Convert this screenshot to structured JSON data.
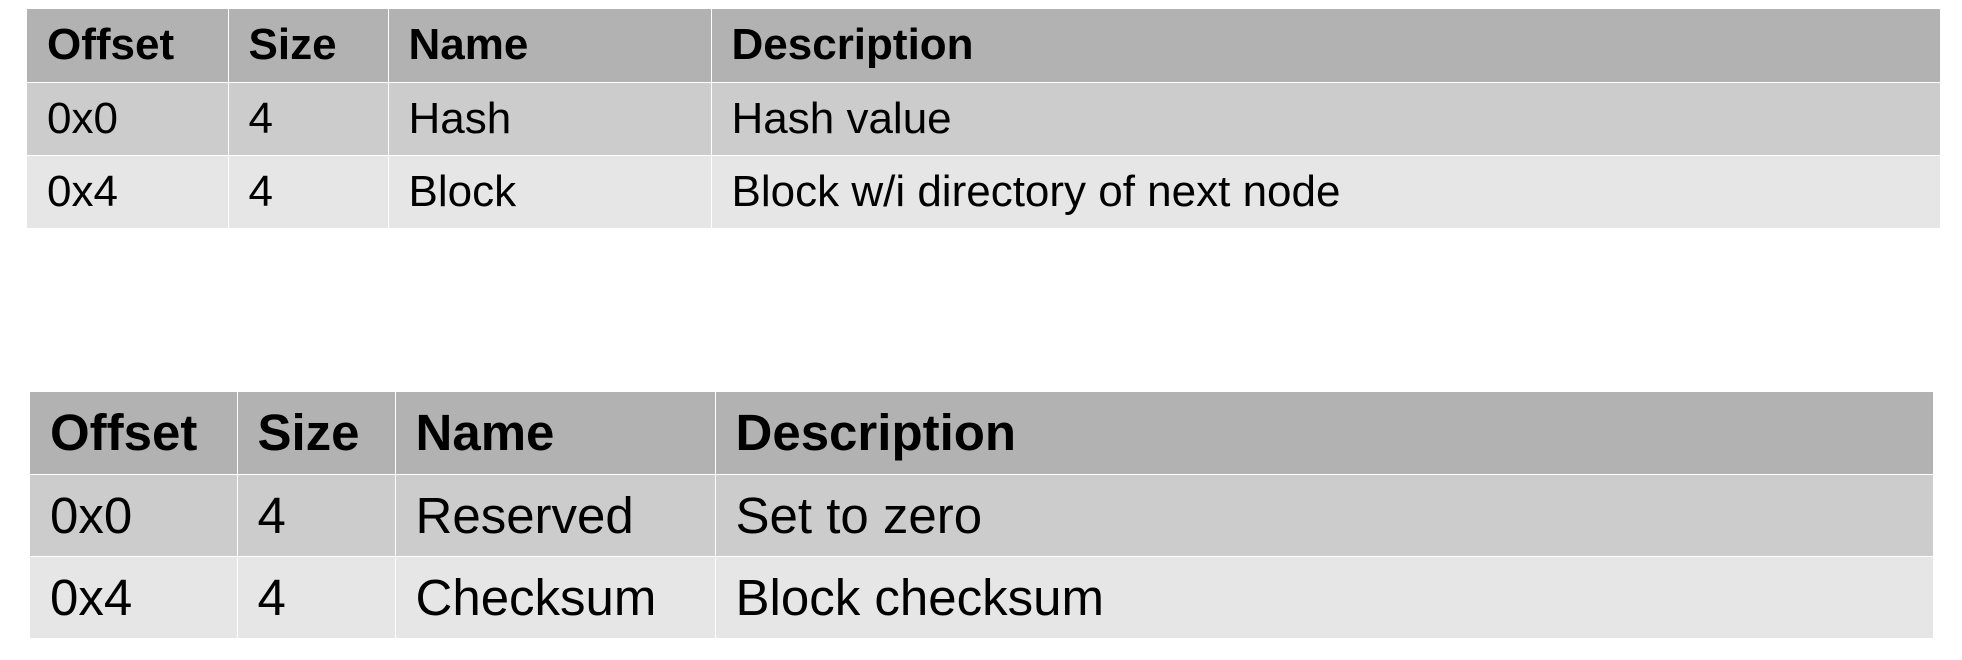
{
  "tables": [
    {
      "headers": [
        "Offset",
        "Size",
        "Name",
        "Description"
      ],
      "rows": [
        [
          "0x0",
          "4",
          "Hash",
          "Hash value"
        ],
        [
          "0x4",
          "4",
          "Block",
          "Block w/i directory of next node"
        ]
      ]
    },
    {
      "headers": [
        "Offset",
        "Size",
        "Name",
        "Description"
      ],
      "rows": [
        [
          "0x0",
          "4",
          "Reserved",
          "Set to zero"
        ],
        [
          "0x4",
          "4",
          "Checksum",
          "Block checksum"
        ]
      ]
    }
  ],
  "colors": {
    "header_bg": "#b2b2b2",
    "row_odd_bg": "#cccccc",
    "row_even_bg": "#e6e6e6",
    "divider": "#ffffff"
  }
}
